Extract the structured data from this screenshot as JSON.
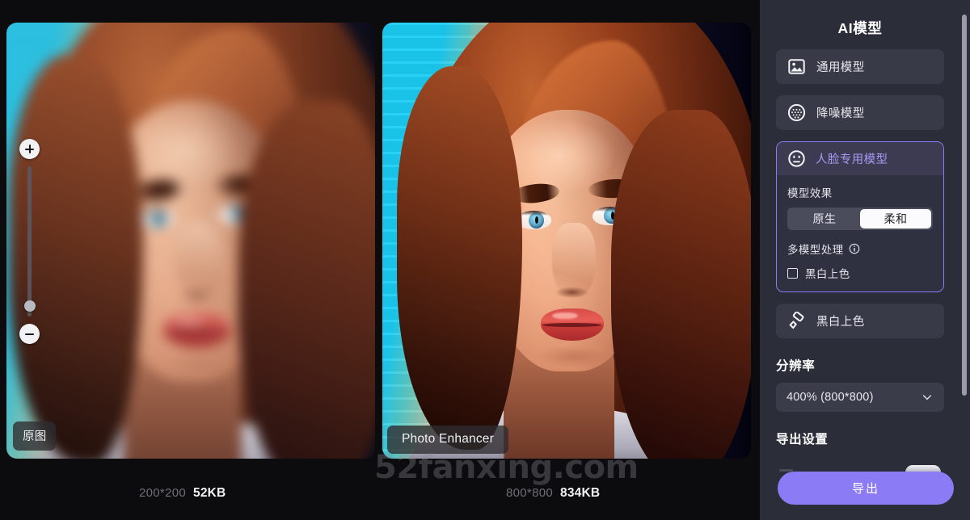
{
  "workspace": {
    "original": {
      "badge": "原图",
      "dimensions": "200*200",
      "filesize": "52KB",
      "zoom_control": {
        "zoom_in": "+",
        "zoom_out": "−"
      }
    },
    "enhanced": {
      "badge": "Photo Enhancer",
      "dimensions": "800*800",
      "filesize": "834KB"
    },
    "watermark": "52fanxing.com"
  },
  "sidebar": {
    "title": "AI模型",
    "models": [
      {
        "icon": "image-icon",
        "label": "通用模型",
        "active": false
      },
      {
        "icon": "noise-circle-icon",
        "label": "降噪模型",
        "active": false
      }
    ],
    "face_model": {
      "icon": "face-icon",
      "label": "人脸专用模型",
      "active": true,
      "effect": {
        "label": "模型效果",
        "options": [
          "原生",
          "柔和"
        ],
        "selected": "柔和"
      },
      "multi_model": {
        "label": "多模型处理",
        "info_icon": "info-icon",
        "checkbox": {
          "label": "黑白上色",
          "checked": false
        }
      }
    },
    "colorize": {
      "icon": "paint-roller-icon",
      "label": "黑白上色"
    },
    "resolution": {
      "title": "分辨率",
      "value": "400% (800*800)",
      "chevron_icon": "chevron-down-icon"
    },
    "export_settings": {
      "title": "导出设置"
    },
    "export_button": {
      "label": "导出"
    },
    "scrollbar": "sidebar-scrollbar"
  },
  "colors": {
    "accent": "#8b7cf6",
    "accent_text": "#a99bf7",
    "sidebar_bg": "#2b2d39",
    "card_bg": "#383a47",
    "canvas_bg": "#0c0c0e"
  }
}
